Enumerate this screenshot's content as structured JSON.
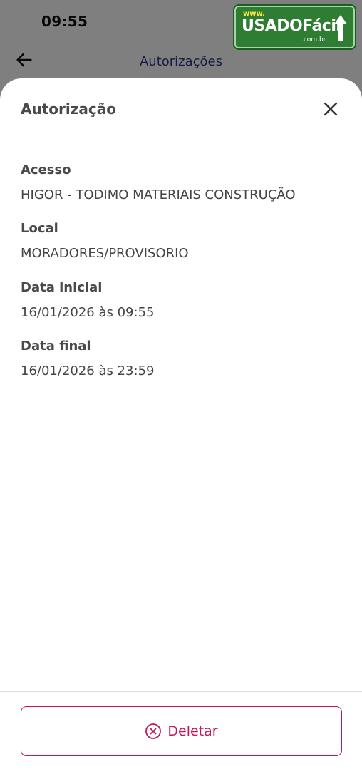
{
  "status_bar": {
    "time": "09:55"
  },
  "app_bar": {
    "title": "Autorizações"
  },
  "watermark": {
    "www": "www.",
    "main": "USADOFácil",
    "domain": ".com.br"
  },
  "sheet": {
    "title": "Autorização",
    "fields": [
      {
        "label": "Acesso",
        "value": "HIGOR  - TODIMO MATERIAIS CONSTRUÇÃO"
      },
      {
        "label": "Local",
        "value": "MORADORES/PROVISORIO"
      },
      {
        "label": "Data inicial",
        "value": "16/01/2026 às 09:55"
      },
      {
        "label": "Data final",
        "value": "16/01/2026 às 23:59"
      }
    ],
    "delete_label": "Deletar"
  },
  "colors": {
    "accent": "#c0185a",
    "title": "#2a3a8c",
    "text": "#4a4a4a"
  },
  "icons": {
    "back": "arrow-left-icon",
    "close": "close-icon",
    "delete": "circle-x-icon"
  }
}
